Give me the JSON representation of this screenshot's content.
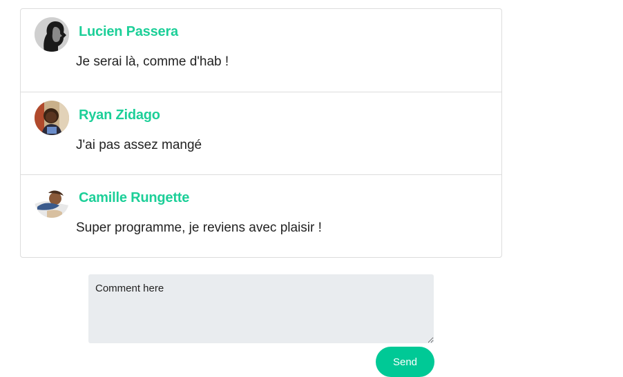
{
  "comments": [
    {
      "author": "Lucien Passera",
      "message": "Je serai là, comme d'hab !",
      "avatar": "profile-photo-avatar"
    },
    {
      "author": "Ryan Zidago",
      "message": "J'ai pas assez mangé",
      "avatar": "profile-photo-avatar"
    },
    {
      "author": "Camille Rungette",
      "message": "Super programme, je reviens avec plaisir !",
      "avatar": "profile-photo-avatar"
    }
  ],
  "form": {
    "placeholder": "Comment here",
    "value": "",
    "send_label": "Send"
  },
  "colors": {
    "author_name": "#1ccf98",
    "send_button": "#00c996",
    "textarea_bg": "#e9ecef"
  }
}
